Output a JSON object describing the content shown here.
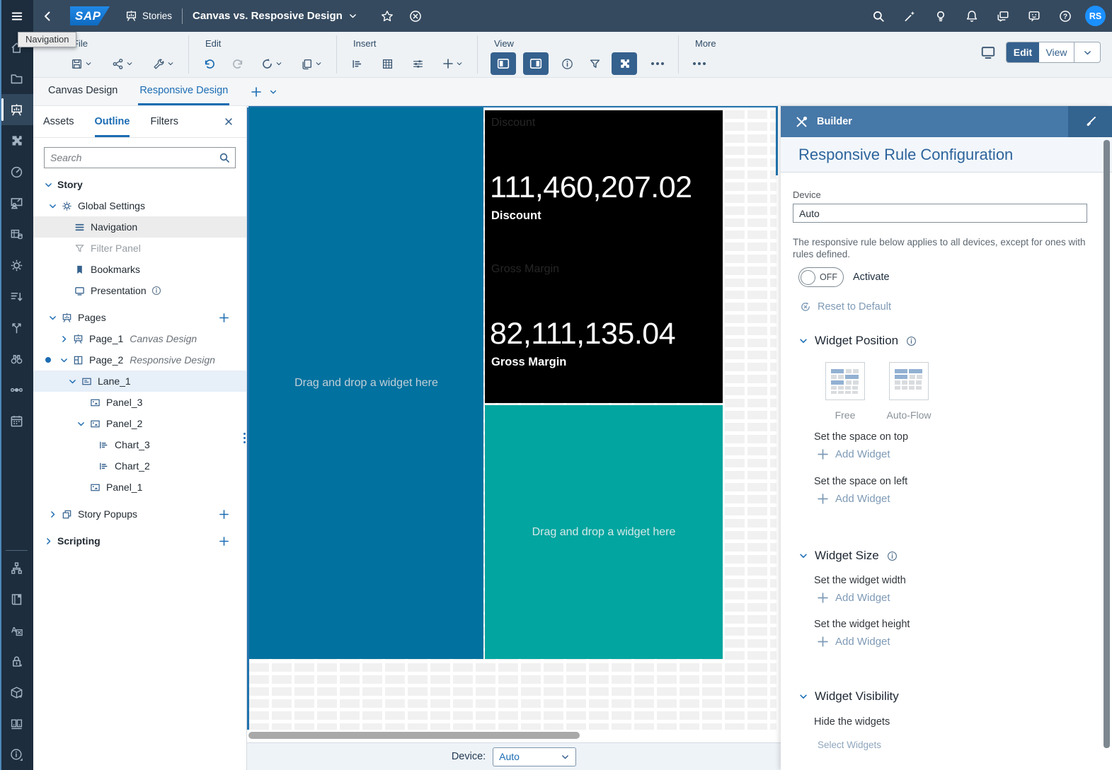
{
  "topbar": {
    "tooltip": "Navigation",
    "logo_text": "SAP",
    "context_label": "Stories",
    "title": "Canvas vs. Resposive Design",
    "avatar_initials": "RS",
    "right_icons": [
      "search-icon",
      "assistant-icon",
      "lightbulb-icon",
      "notifications-bell-icon",
      "discussions-icon",
      "feedback-icon",
      "help-icon"
    ]
  },
  "toolbar": {
    "file_label": "File",
    "edit_label": "Edit",
    "insert_label": "Insert",
    "view_label": "View",
    "more_label": "More",
    "mode_edit": "Edit",
    "mode_view": "View"
  },
  "page_tabs": {
    "canvas": "Canvas Design",
    "responsive": "Responsive Design"
  },
  "sidebar": {
    "tabs": {
      "assets": "Assets",
      "outline": "Outline",
      "filters": "Filters"
    },
    "active_tab": "Outline",
    "search_placeholder": "Search",
    "tree": [
      {
        "label": "Story"
      },
      {
        "label": "Global Settings"
      },
      {
        "label": "Navigation"
      },
      {
        "label": "Filter Panel"
      },
      {
        "label": "Bookmarks"
      },
      {
        "label": "Presentation"
      },
      {
        "label": "Pages"
      },
      {
        "label": "Page_1",
        "sublabel": "Canvas Design"
      },
      {
        "label": "Page_2",
        "sublabel": "Responsive Design"
      },
      {
        "label": "Lane_1"
      },
      {
        "label": "Panel_3"
      },
      {
        "label": "Panel_2"
      },
      {
        "label": "Chart_3"
      },
      {
        "label": "Chart_2"
      },
      {
        "label": "Panel_1"
      },
      {
        "label": "Story Popups"
      },
      {
        "label": "Scripting"
      }
    ]
  },
  "rail_icons": {
    "top": [
      "home-icon",
      "folder-icon",
      "story-board-icon",
      "extensions-puzzle-icon",
      "kpi-gauge-icon",
      "presentation-person-icon",
      "dataset-table-icon",
      "settings-gear-icon",
      "sort-list-icon",
      "branch-arrows-icon",
      "binoculars-icon",
      "link-nodes-icon",
      "calendar-icon"
    ],
    "bottom": [
      "hierarchy-icon",
      "catalog-book-icon",
      "translation-icon",
      "lock-icon",
      "package-box-icon",
      "servers-icon",
      "info-icon"
    ]
  },
  "canvas": {
    "lane_hint": "Drag and drop a widget here",
    "panel_hint": "Drag and drop a widget here",
    "kpis": [
      {
        "widget_title": "Discount",
        "value": "111,460,207.02",
        "label": "Discount"
      },
      {
        "widget_title": "Gross Margin",
        "value": "82,111,135.04",
        "label": "Gross Margin"
      }
    ],
    "device_label": "Device:",
    "device_value": "Auto"
  },
  "builder": {
    "header": "Builder",
    "title": "Responsive Rule Configuration",
    "device_label": "Device",
    "device_value": "Auto",
    "note": "The responsive rule below applies to all devices, except for ones with rules defined.",
    "toggle_state": "OFF",
    "toggle_label": "Activate",
    "reset_label": "Reset to Default",
    "widget_position": {
      "title": "Widget Position",
      "free_label": "Free",
      "autoflow_label": "Auto-Flow",
      "rows": [
        {
          "label": "Set the space on top",
          "action": "Add Widget"
        },
        {
          "label": "Set the space on left",
          "action": "Add Widget"
        }
      ]
    },
    "widget_size": {
      "title": "Widget Size",
      "rows": [
        {
          "label": "Set the widget width",
          "action": "Add Widget"
        },
        {
          "label": "Set the widget height",
          "action": "Add Widget"
        }
      ]
    },
    "widget_visibility": {
      "title": "Widget Visibility",
      "label": "Hide the widgets",
      "action": "Select Widgets"
    }
  },
  "colors": {
    "topbar": "#354a5f",
    "rail": "#1d2d3e",
    "accent_blue": "#1b6cb3",
    "active_button": "#35618e",
    "lane_blue": "#01719f",
    "teal_panel": "#02a59f",
    "kpi_background": "#000000",
    "builder_header": "#4678a8"
  }
}
